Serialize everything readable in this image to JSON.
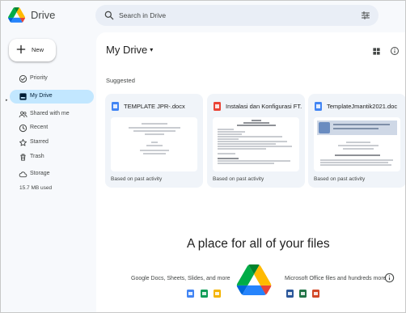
{
  "app": {
    "name": "Drive"
  },
  "search": {
    "placeholder": "Search in Drive"
  },
  "new_button": {
    "label": "New"
  },
  "sidebar": {
    "items": [
      {
        "label": "Priority",
        "icon": "priority-icon"
      },
      {
        "label": "My Drive",
        "icon": "my-drive-icon",
        "active": true
      },
      {
        "label": "Shared with me",
        "icon": "shared-icon"
      },
      {
        "label": "Recent",
        "icon": "clock-icon"
      },
      {
        "label": "Starred",
        "icon": "star-icon"
      },
      {
        "label": "Trash",
        "icon": "trash-icon"
      },
      {
        "label": "Storage",
        "icon": "cloud-icon"
      }
    ],
    "storage_used": "15.7 MB used"
  },
  "main": {
    "title": "My Drive",
    "title_caret": "▾",
    "suggested_label": "Suggested",
    "cards": [
      {
        "name": "TEMPLATE JPR-.docx",
        "type": "doc",
        "reason": "Based on past activity"
      },
      {
        "name": "Instalasi dan Konfigurasi FT...",
        "type": "pdf",
        "reason": "Based on past activity"
      },
      {
        "name": "TemplateJmantik2021.doc",
        "type": "doc",
        "reason": "Based on past activity"
      }
    ],
    "empty_state": {
      "title": "A place for all of your files",
      "left_text": "Google Docs, Sheets, Slides, and more",
      "right_text": "Microsoft Office files and hundreds more"
    }
  },
  "colors": {
    "accent_active": "#c2e7ff",
    "search_bg": "#e9eef6",
    "doc_blue": "#4285f4",
    "pdf_red": "#ea4335",
    "sheet_green": "#0f9d58",
    "slide_yellow": "#f4b400",
    "word_blue": "#2b579a",
    "excel_green": "#217346",
    "ppt_orange": "#d24726"
  }
}
